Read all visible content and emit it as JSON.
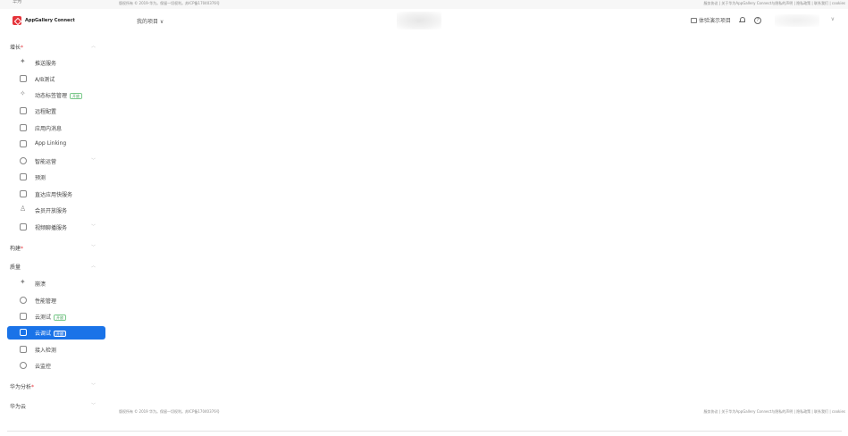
{
  "top_strip": {
    "left_cut_text": "华为",
    "copyright": "版权所有 © 2019-华为。保留一切权利。苏ICP备17040376号",
    "links": "服务协议 | 关于华为AppGallery Connect与隐私的声明 | 隐私政策 | 联系我们 | cookies"
  },
  "header": {
    "brand": "AppGallery Connect",
    "project_selector": "我的项目 ∨",
    "demo_project": "体验演示项目",
    "help_glyph": "?",
    "account_chevron": "∨"
  },
  "sidebar": {
    "groups": [
      {
        "title": "增长",
        "starred": true,
        "chevron": "︿",
        "items": [
          {
            "label": "推送服务",
            "icon": "push-icon"
          },
          {
            "label": "A/B测试",
            "icon": "ab-test-icon"
          },
          {
            "label": "动态标签管理",
            "badge": "开放",
            "icon": "tag-icon"
          },
          {
            "label": "远程配置",
            "icon": "remote-config-icon"
          },
          {
            "label": "应用内消息",
            "icon": "in-app-message-icon"
          },
          {
            "label": "App Linking",
            "icon": "app-linking-icon"
          },
          {
            "label": "智能运营",
            "chevron": "﹀",
            "icon": "smart-ops-icon"
          },
          {
            "label": "预测",
            "icon": "prediction-icon"
          },
          {
            "label": "直达应用快服务",
            "icon": "quick-service-icon"
          },
          {
            "label": "会员开放服务",
            "icon": "member-service-icon"
          },
          {
            "label": "视频聊播服务",
            "chevron": "﹀",
            "icon": "video-service-icon"
          }
        ]
      },
      {
        "title": "构建",
        "starred": true,
        "chevron": "﹀",
        "items": []
      },
      {
        "title": "质量",
        "starred": false,
        "chevron": "︿",
        "items": [
          {
            "label": "崩溃",
            "icon": "crash-icon"
          },
          {
            "label": "性能管理",
            "icon": "performance-icon"
          },
          {
            "label": "云测试",
            "badge": "开放",
            "icon": "cloud-test-icon"
          },
          {
            "label": "云调试",
            "badge": "开放",
            "icon": "cloud-debug-icon",
            "active": true
          },
          {
            "label": "接入检测",
            "icon": "access-check-icon"
          },
          {
            "label": "云监控",
            "icon": "cloud-monitor-icon"
          }
        ]
      },
      {
        "title": "华为分析",
        "starred": true,
        "chevron": "﹀",
        "items": []
      },
      {
        "title": "华为云",
        "starred": false,
        "chevron": "﹀",
        "items": []
      }
    ]
  },
  "footer": {
    "copyright": "版权所有 © 2019 华为。保留一切权利。苏ICP备17040376号",
    "links": "服务协议 | 关于华为AppGallery Connect与隐私的声明 | 隐私政策 | 联系我们 | cookies"
  }
}
